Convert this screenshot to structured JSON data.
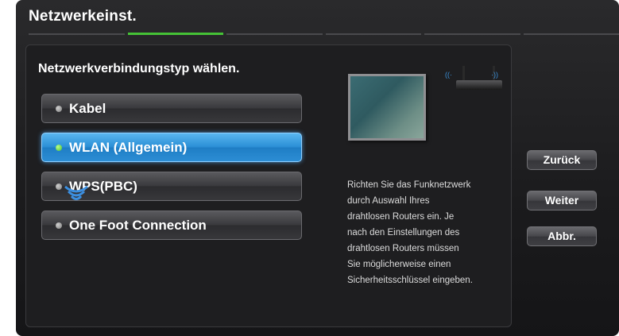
{
  "dialog": {
    "title": "Netzwerkeinst."
  },
  "steps": {
    "count": 6,
    "active_index": 1
  },
  "main": {
    "subtitle": "Netzwerkverbindungstyp wählen.",
    "options": [
      {
        "label": "Kabel",
        "selected": false
      },
      {
        "label": "WLAN (Allgemein)",
        "selected": true
      },
      {
        "label": "WPS(PBC)",
        "selected": false
      },
      {
        "label": "One Foot Connection",
        "selected": false
      }
    ],
    "help_lines": [
      "Richten Sie das Funknetzwerk",
      "durch Auswahl Ihres",
      "drahtlosen Routers ein. Je",
      "nach den Einstellungen des",
      "drahtlosen Routers müssen",
      "Sie möglicherweise einen",
      "Sicherheitsschlüssel eingeben."
    ]
  },
  "buttons": {
    "back": "Zurück",
    "next": "Weiter",
    "cancel": "Abbr."
  },
  "colors": {
    "accent_selected": "#2b8fd6",
    "step_active": "#45c236",
    "background": "#1b1b1d"
  },
  "icons": {
    "option_bullet": "radio-dot-icon",
    "illustration_tv": "tv-icon",
    "illustration_router": "router-icon",
    "wireless": "wifi-signal-icon"
  }
}
